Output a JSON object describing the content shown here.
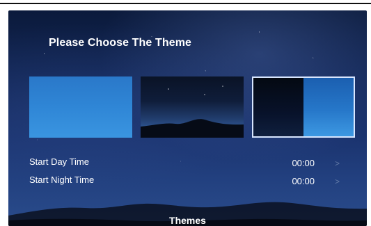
{
  "screen": {
    "title": "Please Choose The Theme",
    "themes": [
      {
        "name": "day-theme"
      },
      {
        "name": "night-theme"
      },
      {
        "name": "auto-theme",
        "selected": true
      }
    ],
    "settings": [
      {
        "label": "Start Day Time",
        "value": "00:00",
        "icon": "chevron-right-icon"
      },
      {
        "label": "Start Night Time",
        "value": "00:00",
        "icon": "chevron-right-icon"
      }
    ],
    "footer_title": "Themes"
  },
  "colors": {
    "accent_border": "#d8e6ff",
    "day_blue": "#2f86d6",
    "night_dark": "#0f1d3a"
  }
}
